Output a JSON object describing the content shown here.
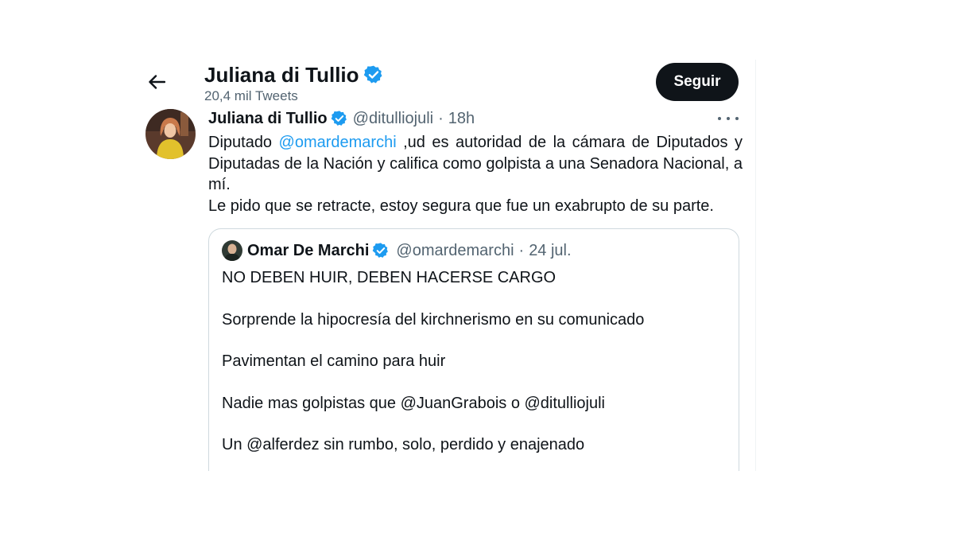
{
  "header": {
    "back_icon": "arrow-left-icon",
    "name": "Juliana di Tullio",
    "tweet_count": "20,4 mil Tweets",
    "follow_label": "Seguir"
  },
  "tweet": {
    "name": "Juliana di Tullio",
    "handle": "@ditulliojuli",
    "separator": "·",
    "time": "18h",
    "text_prefix": "Diputado ",
    "mention": "@omardemarchi",
    "text_rest": " ,ud es autoridad de la cámara de Diputados y Diputadas de la Nación y califica como golpista a una Senadora Nacional, a mí.",
    "text_line2": "Le pido que se retracte, estoy segura que fue un exabrupto de su parte."
  },
  "quote": {
    "name": "Omar De Marchi",
    "handle": "@omardemarchi",
    "separator": "·",
    "time": "24 jul.",
    "paragraphs": [
      "NO DEBEN HUIR, DEBEN HACERSE CARGO",
      "Sorprende la hipocresía del kirchnerismo en su comunicado",
      "Pavimentan el camino para huir",
      "Nadie mas golpistas que @JuanGrabois o @ditulliojuli",
      "Un @alferdez sin rumbo, solo, perdido y enajenado"
    ]
  },
  "colors": {
    "verified_blue": "#1d9bf0",
    "link_blue": "#1d9bf0",
    "secondary_text": "#536471",
    "button_bg": "#0f1419"
  }
}
